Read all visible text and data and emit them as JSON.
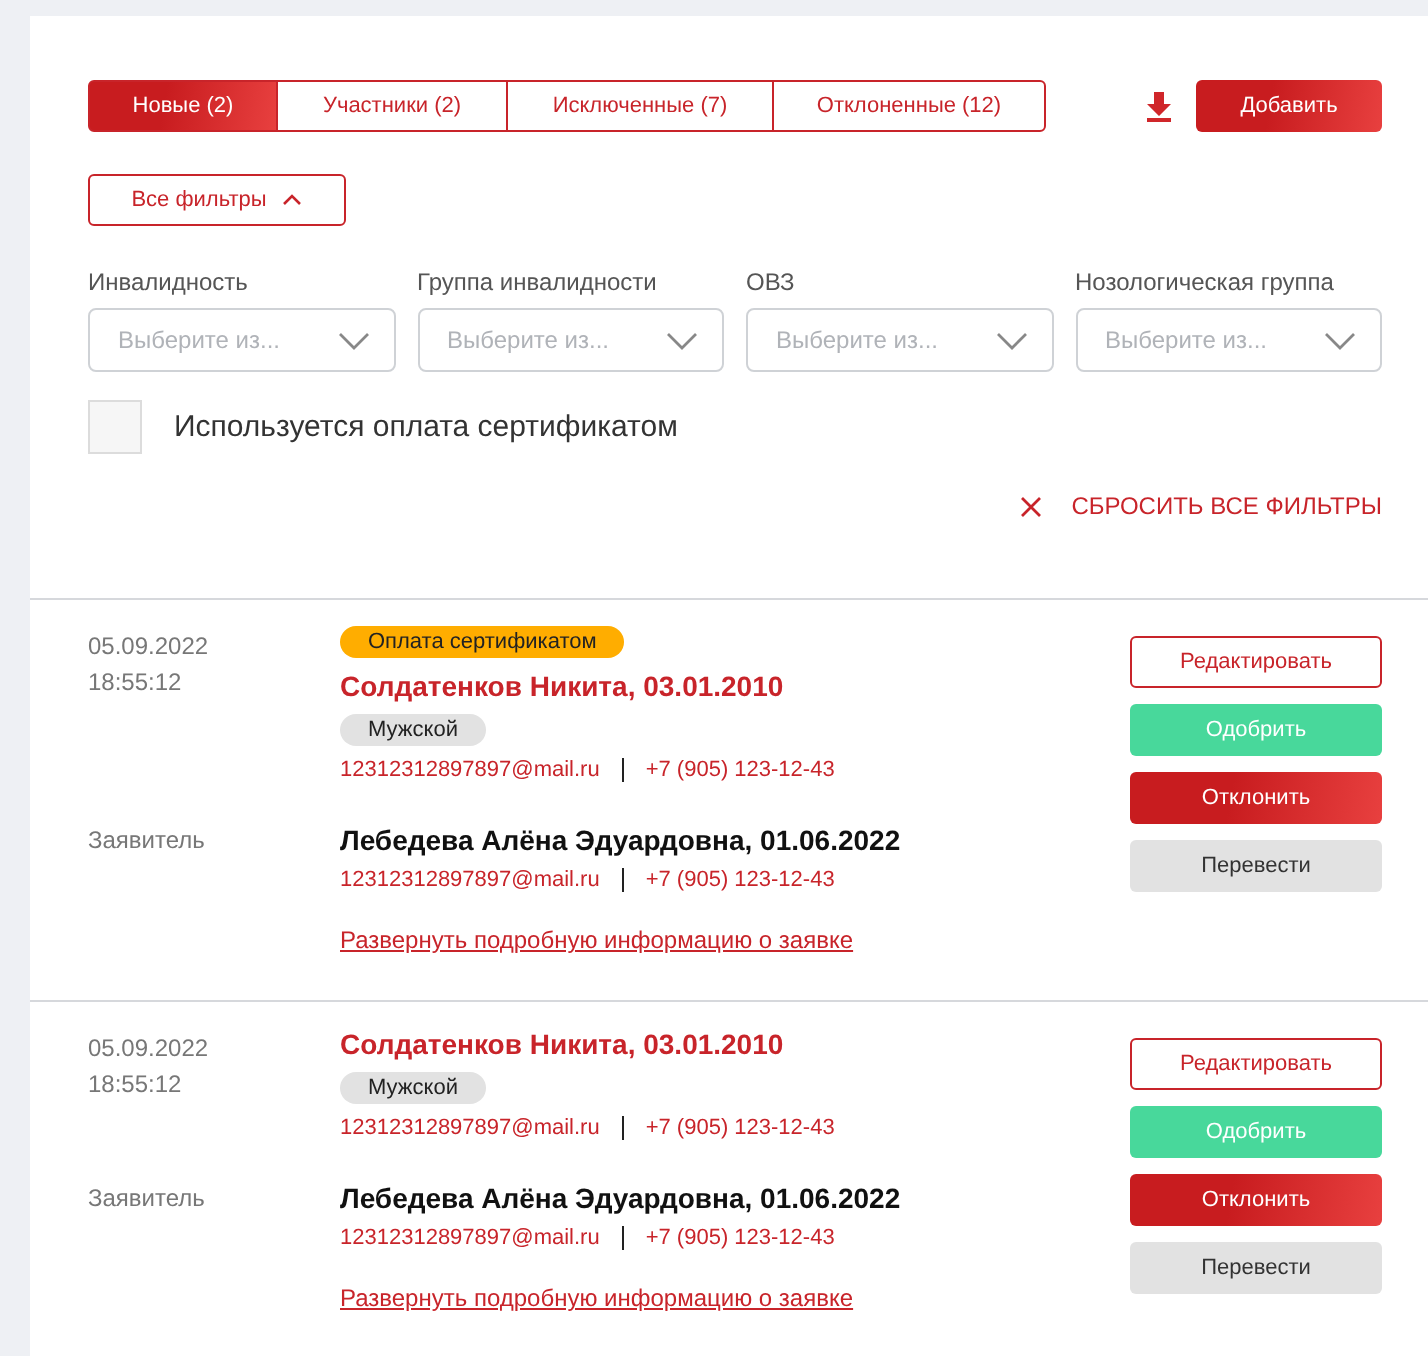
{
  "tabs": [
    {
      "label": "Новые (2)",
      "selected": true
    },
    {
      "label": "Участники (2)",
      "selected": false
    },
    {
      "label": "Исключенные (7)",
      "selected": false
    },
    {
      "label": "Отклоненные (12)",
      "selected": false
    }
  ],
  "add_button": "Добавить",
  "filters_button": {
    "label": "Все фильтры",
    "expanded": true
  },
  "filters": [
    {
      "label": "Инвалидность",
      "placeholder": "Выберите из..."
    },
    {
      "label": "Группа инвалидности",
      "placeholder": "Выберите из..."
    },
    {
      "label": "ОВЗ",
      "placeholder": "Выберите из..."
    },
    {
      "label": "Нозологическая группа",
      "placeholder": "Выберите из..."
    }
  ],
  "certificate_checkbox": {
    "label": "Используется оплата сертификатом",
    "checked": false
  },
  "reset_filters": "СБРОСИТЬ ВСЕ ФИЛЬТРЫ",
  "applications": [
    {
      "date": "05.09.2022",
      "time": "18:55:12",
      "badge": "Оплата сертификатом",
      "name": "Солдатенков Никита, 03.01.2010",
      "gender": "Мужской",
      "email": "12312312897897@mail.ru",
      "phone": "+7 (905) 123-12-43",
      "applicant_label": "Заявитель",
      "applicant_name": "Лебедева Алёна Эдуардовна, 01.06.2022",
      "applicant_email": "12312312897897@mail.ru",
      "applicant_phone": "+7 (905) 123-12-43",
      "details_link": "Развернуть подробную информацию о заявке",
      "actions": [
        {
          "kind": "edit",
          "label": "Редактировать"
        },
        {
          "kind": "approve",
          "label": "Одобрить"
        },
        {
          "kind": "reject",
          "label": "Отклонить"
        },
        {
          "kind": "transfer",
          "label": "Перевести"
        }
      ]
    },
    {
      "date": "05.09.2022",
      "time": "18:55:12",
      "name": "Солдатенков Никита, 03.01.2010",
      "gender": "Мужской",
      "email": "12312312897897@mail.ru",
      "phone": "+7 (905) 123-12-43",
      "applicant_label": "Заявитель",
      "applicant_name": "Лебедева Алёна Эдуардовна, 01.06.2022",
      "applicant_email": "12312312897897@mail.ru",
      "applicant_phone": "+7 (905) 123-12-43",
      "details_link": "Развернуть подробную информацию о заявке",
      "actions": [
        {
          "kind": "edit",
          "label": "Редактировать"
        },
        {
          "kind": "approve",
          "label": "Одобрить"
        },
        {
          "kind": "reject",
          "label": "Отклонить"
        },
        {
          "kind": "transfer",
          "label": "Перевести"
        }
      ]
    }
  ]
}
